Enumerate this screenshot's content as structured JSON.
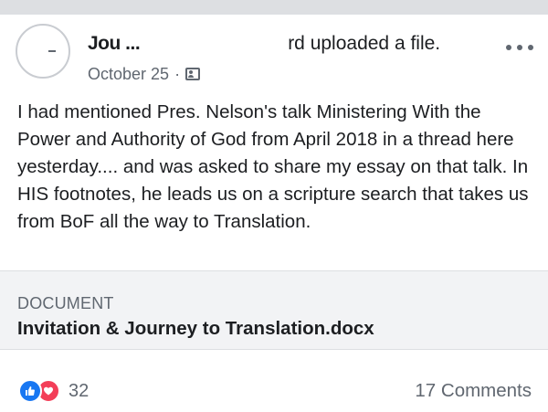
{
  "post": {
    "author_name": "Jou ...",
    "action_text": "rd uploaded a file.",
    "date": "October 25",
    "date_separator": "·",
    "body": "I had mentioned Pres. Nelson's talk Ministering With the Power and Authority of God from April 2018 in a thread here yesterday.... and was asked to share my essay on that talk.  In HIS footnotes, he leads us on a scripture search that takes us from BoF all the way to Translation."
  },
  "attachment": {
    "type_label": "DOCUMENT",
    "file_name": "Invitation & Journey to Translation.docx"
  },
  "footer": {
    "reaction_count": "32",
    "comments_label": "17 Comments"
  },
  "icons": {
    "more": "more-options-icon",
    "audience": "audience-icon",
    "like": "like-icon",
    "love": "love-icon"
  },
  "colors": {
    "like_blue": "#1877f2",
    "love_red": "#f33e58",
    "secondary_text": "#606770",
    "attachment_bg": "#f2f3f5"
  }
}
